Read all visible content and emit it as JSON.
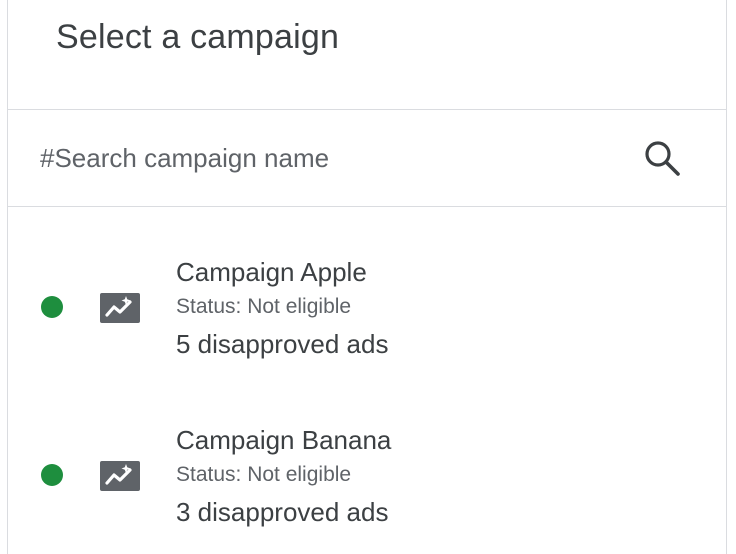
{
  "header": {
    "title": "Select a campaign"
  },
  "search": {
    "placeholder": "#Search campaign name",
    "value": "",
    "icon": "search-icon"
  },
  "campaigns": [
    {
      "name": "Campaign Apple",
      "status": "Status: Not eligible",
      "disapproved": "5 disapproved ads",
      "dot_color": "#1e8e3e",
      "icon": "campaign-performance-icon"
    },
    {
      "name": "Campaign Banana",
      "status": "Status: Not eligible",
      "disapproved": "3 disapproved ads",
      "dot_color": "#1e8e3e",
      "icon": "campaign-performance-icon"
    }
  ],
  "colors": {
    "text_primary": "#3c4043",
    "text_secondary": "#5f6368",
    "divider": "#dadce0",
    "icon_bg": "#5f6368",
    "status_green": "#1e8e3e"
  }
}
